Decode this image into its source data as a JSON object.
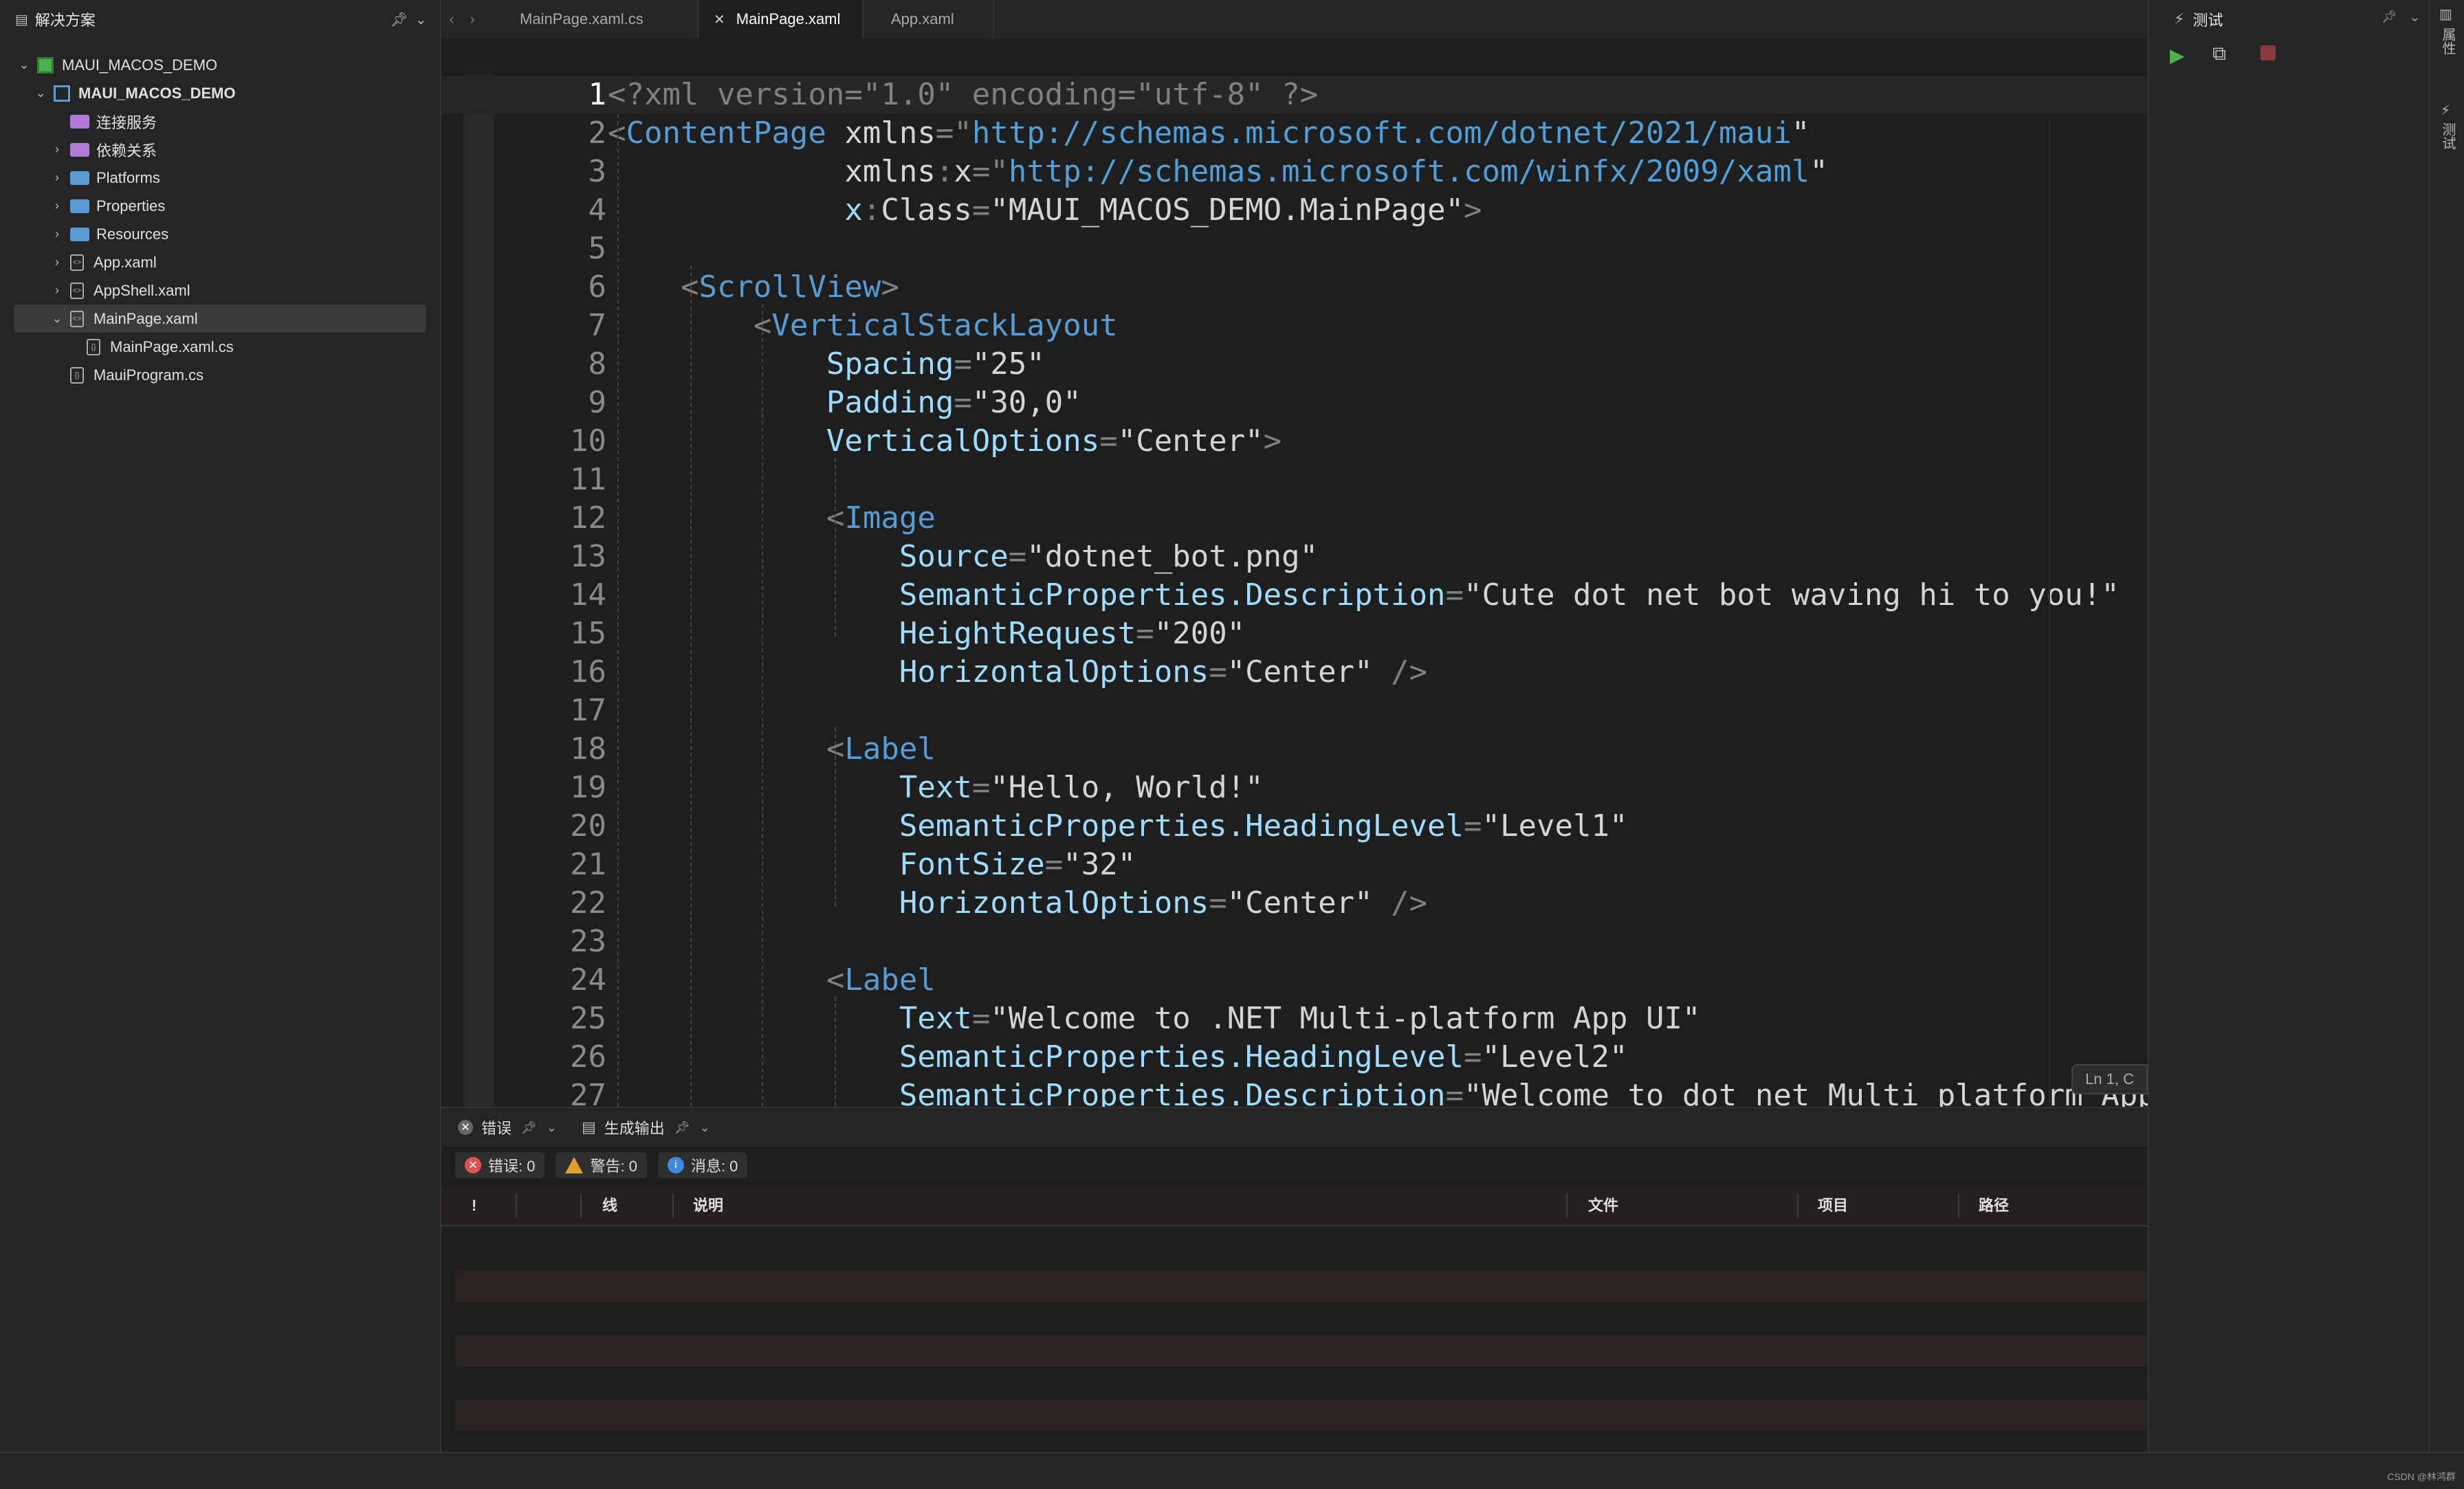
{
  "solution": {
    "title": "解决方案",
    "items": [
      {
        "label": "MAUI_MACOS_DEMO",
        "kind": "solution",
        "indent": 0,
        "chevron": "v"
      },
      {
        "label": "MAUI_MACOS_DEMO",
        "kind": "project",
        "indent": 1,
        "chevron": "v",
        "bold": true
      },
      {
        "label": "连接服务",
        "kind": "folder-purple",
        "indent": 2,
        "chevron": ""
      },
      {
        "label": "依赖关系",
        "kind": "folder-purple",
        "indent": 2,
        "chevron": ">"
      },
      {
        "label": "Platforms",
        "kind": "folder",
        "indent": 2,
        "chevron": ">"
      },
      {
        "label": "Properties",
        "kind": "folder",
        "indent": 2,
        "chevron": ">"
      },
      {
        "label": "Resources",
        "kind": "folder",
        "indent": 2,
        "chevron": ">"
      },
      {
        "label": "App.xaml",
        "kind": "xaml",
        "indent": 2,
        "chevron": ">"
      },
      {
        "label": "AppShell.xaml",
        "kind": "xaml",
        "indent": 2,
        "chevron": ">"
      },
      {
        "label": "MainPage.xaml",
        "kind": "xaml",
        "indent": 2,
        "chevron": "v",
        "selected": true
      },
      {
        "label": "MainPage.xaml.cs",
        "kind": "cs",
        "indent": 3,
        "chevron": ""
      },
      {
        "label": "MauiProgram.cs",
        "kind": "cs",
        "indent": 2,
        "chevron": ""
      }
    ]
  },
  "tabs": [
    {
      "label": "MainPage.xaml.cs",
      "active": false
    },
    {
      "label": "MainPage.xaml",
      "active": true
    },
    {
      "label": "App.xaml",
      "active": false
    }
  ],
  "editor": {
    "current_line": 1,
    "lines": [
      [
        [
          "p",
          "<?xml version=\"1.0\" encoding=\"utf-8\" ?>"
        ]
      ],
      [
        [
          "p",
          "<"
        ],
        [
          "t",
          "ContentPage"
        ],
        [
          "tx",
          " xmlns"
        ],
        [
          "p",
          "=\""
        ],
        [
          "u",
          "http://schemas.microsoft.com/dotnet/2021/maui"
        ],
        [
          "tx",
          "\""
        ]
      ],
      [
        [
          "tx",
          "             xmlns"
        ],
        [
          "p",
          ":"
        ],
        [
          "tx",
          "x"
        ],
        [
          "p",
          "=\""
        ],
        [
          "u",
          "http://schemas.microsoft.com/winfx/2009/xaml"
        ],
        [
          "tx",
          "\""
        ]
      ],
      [
        [
          "tx",
          "             "
        ],
        [
          "a",
          "x"
        ],
        [
          "p",
          ":"
        ],
        [
          "tx",
          "Class"
        ],
        [
          "p",
          "="
        ],
        [
          "tx",
          "\"MAUI_MACOS_DEMO.MainPage\""
        ],
        [
          "p",
          ">"
        ]
      ],
      [],
      [
        [
          "p",
          "    <"
        ],
        [
          "t",
          "ScrollView"
        ],
        [
          "p",
          ">"
        ]
      ],
      [
        [
          "p",
          "        <"
        ],
        [
          "t",
          "VerticalStackLayout"
        ]
      ],
      [
        [
          "a",
          "            Spacing"
        ],
        [
          "p",
          "="
        ],
        [
          "tx",
          "\"25\""
        ]
      ],
      [
        [
          "a",
          "            Padding"
        ],
        [
          "p",
          "="
        ],
        [
          "tx",
          "\"30,0\""
        ]
      ],
      [
        [
          "a",
          "            VerticalOptions"
        ],
        [
          "p",
          "="
        ],
        [
          "tx",
          "\"Center\""
        ],
        [
          "p",
          ">"
        ]
      ],
      [],
      [
        [
          "p",
          "            <"
        ],
        [
          "t",
          "Image"
        ]
      ],
      [
        [
          "a",
          "                Source"
        ],
        [
          "p",
          "="
        ],
        [
          "tx",
          "\"dotnet_bot.png\""
        ]
      ],
      [
        [
          "a",
          "                SemanticProperties.Description"
        ],
        [
          "p",
          "="
        ],
        [
          "tx",
          "\"Cute dot net bot waving hi to you!\""
        ]
      ],
      [
        [
          "a",
          "                HeightRequest"
        ],
        [
          "p",
          "="
        ],
        [
          "tx",
          "\"200\""
        ]
      ],
      [
        [
          "a",
          "                HorizontalOptions"
        ],
        [
          "p",
          "="
        ],
        [
          "tx",
          "\"Center\""
        ],
        [
          "p",
          " />"
        ]
      ],
      [],
      [
        [
          "p",
          "            <"
        ],
        [
          "t",
          "Label"
        ]
      ],
      [
        [
          "a",
          "                Text"
        ],
        [
          "p",
          "="
        ],
        [
          "tx",
          "\"Hello, World!\""
        ]
      ],
      [
        [
          "a",
          "                SemanticProperties.HeadingLevel"
        ],
        [
          "p",
          "="
        ],
        [
          "tx",
          "\"Level1\""
        ]
      ],
      [
        [
          "a",
          "                FontSize"
        ],
        [
          "p",
          "="
        ],
        [
          "tx",
          "\"32\""
        ]
      ],
      [
        [
          "a",
          "                HorizontalOptions"
        ],
        [
          "p",
          "="
        ],
        [
          "tx",
          "\"Center\""
        ],
        [
          "p",
          " />"
        ]
      ],
      [],
      [
        [
          "p",
          "            <"
        ],
        [
          "t",
          "Label"
        ]
      ],
      [
        [
          "a",
          "                Text"
        ],
        [
          "p",
          "="
        ],
        [
          "tx",
          "\"Welcome to .NET Multi-platform App UI\""
        ]
      ],
      [
        [
          "a",
          "                SemanticProperties.HeadingLevel"
        ],
        [
          "p",
          "="
        ],
        [
          "tx",
          "\"Level2\""
        ]
      ],
      [
        [
          "a",
          "                SemanticProperties.Description"
        ],
        [
          "p",
          "="
        ],
        [
          "tx",
          "\"Welcome to dot net Multi platform App"
        ]
      ]
    ],
    "position_badge": "Ln 1, C"
  },
  "error_panel": {
    "tab_errors": "错误",
    "tab_output": "生成输出",
    "errors_label": "错误: 0",
    "warnings_label": "警告: 0",
    "messages_label": "消息: 0",
    "columns": [
      "!",
      "",
      "线",
      "说明",
      "文件",
      "项目",
      "路径"
    ]
  },
  "test_panel": {
    "title": "测试"
  },
  "side_strip": {
    "labels": [
      "属性",
      "测试"
    ]
  },
  "status": {
    "watermark": "CSDN @林鸿群"
  },
  "colors": {
    "tag": "#569cd6",
    "attribute": "#9cdcfe",
    "url": "#4f9fdb",
    "punct": "#808080",
    "error": "#e05252",
    "warning": "#e0a030",
    "info": "#3c8bdc",
    "run": "#4caf50"
  }
}
